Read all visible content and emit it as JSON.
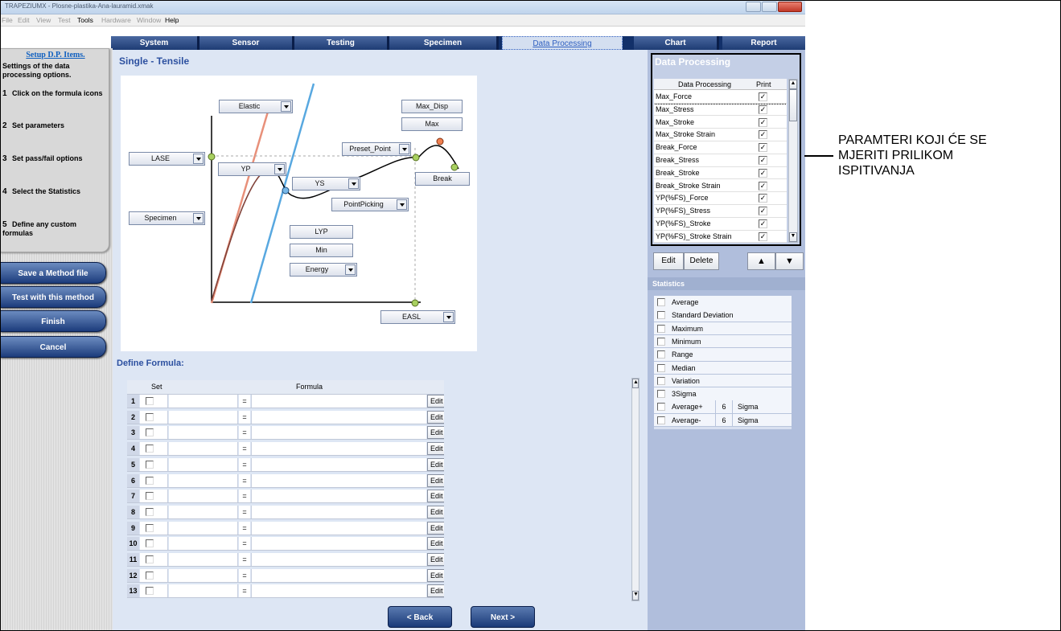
{
  "window": {
    "title": "TRAPEZIUMX - Plosne-plastika-Ana-lauramid.xmak"
  },
  "menu": {
    "items": [
      "File",
      "Edit",
      "View",
      "Test",
      "Tools",
      "Hardware",
      "Window",
      "Help"
    ]
  },
  "tabs": [
    "System",
    "Sensor",
    "Testing",
    "Specimen",
    "Data Processing",
    "Chart",
    "Report"
  ],
  "selected_tab": "Data Processing",
  "help": {
    "title": "Setup D.P. Items.",
    "subtitle": "Settings of the data processing options.",
    "steps": [
      {
        "n": "1",
        "text": "Click on the formula icons"
      },
      {
        "n": "2",
        "text": "Set parameters"
      },
      {
        "n": "3",
        "text": "Set pass/fail options"
      },
      {
        "n": "4",
        "text": "Select the Statistics"
      },
      {
        "n": "5",
        "text": "Define any custom formulas"
      }
    ]
  },
  "side_buttons": {
    "save": "Save a Method file",
    "test": "Test with this method",
    "finish": "Finish",
    "cancel": "Cancel"
  },
  "main": {
    "title": "Single - Tensile",
    "diagram": {
      "elastic": "Elastic",
      "max_disp": "Max_Disp",
      "max": "Max",
      "preset_point": "Preset_Point",
      "lase": "LASE",
      "yp": "YP",
      "ys": "YS",
      "break": "Break",
      "point_picking": "PointPicking",
      "specimen": "Specimen",
      "lyp": "LYP",
      "min": "Min",
      "energy": "Energy",
      "easl": "EASL"
    },
    "define_formula": "Define Formula:",
    "columns": {
      "set": "Set",
      "formula": "Formula"
    },
    "rows": [
      "1",
      "2",
      "3",
      "4",
      "5",
      "6",
      "7",
      "8",
      "9",
      "10",
      "11",
      "12",
      "13"
    ],
    "eq": "=",
    "edit": "Edit"
  },
  "nav": {
    "back": "< Back",
    "next": "Next >"
  },
  "right": {
    "title": "Data Processing",
    "columns": {
      "name": "Data Processing",
      "print": "Print"
    },
    "items": [
      "Max_Force",
      "Max_Stress",
      "Max_Stroke",
      "Max_Stroke Strain",
      "Break_Force",
      "Break_Stress",
      "Break_Stroke",
      "Break_Stroke Strain",
      "YP(%FS)_Force",
      "YP(%FS)_Stress",
      "YP(%FS)_Stroke",
      "YP(%FS)_Stroke Strain"
    ],
    "check": "✓",
    "edit": "Edit",
    "delete": "Delete",
    "up": "▲",
    "down": "▼",
    "statistics_label": "Statistics",
    "statistics": [
      "Average",
      "Standard Deviation",
      "Maximum",
      "Minimum",
      "Range",
      "Median",
      "Variation",
      "3Sigma"
    ],
    "avg_plus": {
      "label": "Average+",
      "n": "6",
      "unit": "Sigma"
    },
    "avg_minus": {
      "label": "Average-",
      "n": "6",
      "unit": "Sigma"
    }
  },
  "annotation": [
    "PARAMTERI KOJI ĆE SE",
    "MJERITI PRILIKOM",
    "ISPITIVANJA"
  ]
}
